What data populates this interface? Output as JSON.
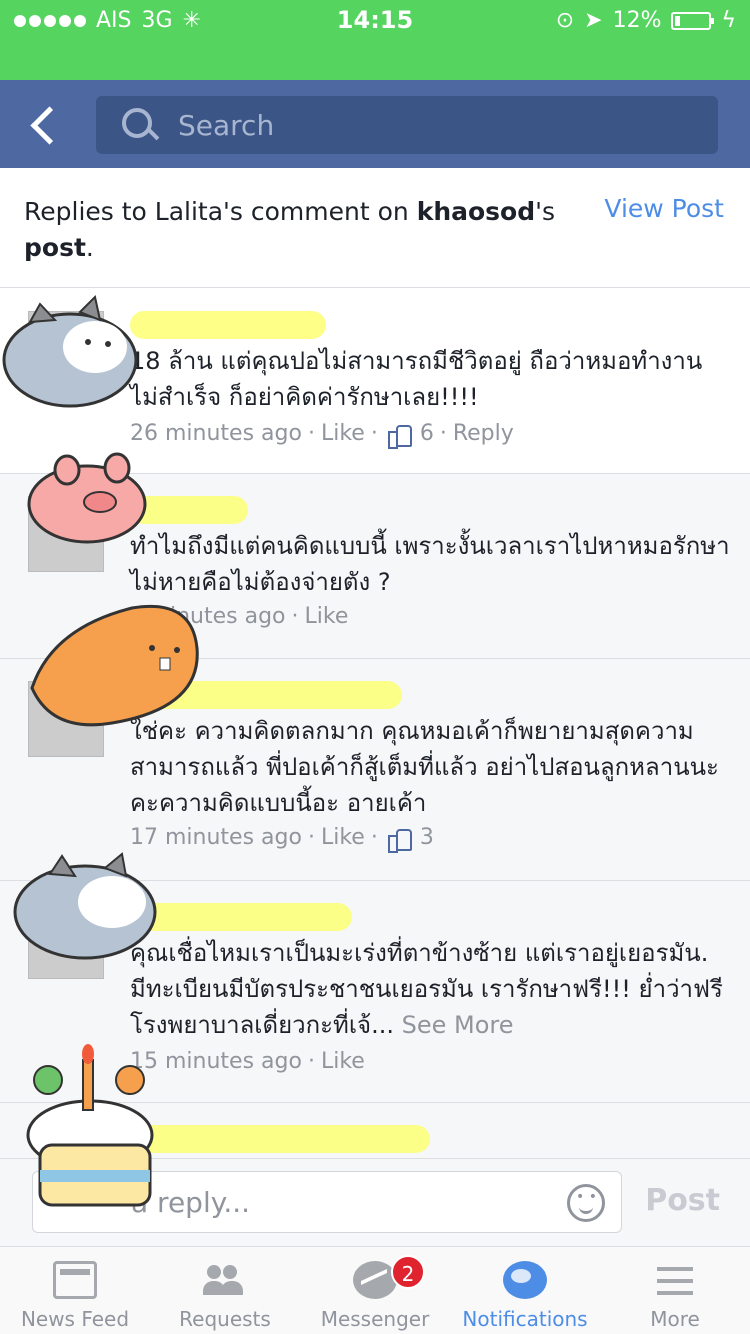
{
  "status": {
    "carrier": "AIS",
    "network": "3G",
    "time": "14:15",
    "battery": "12%"
  },
  "header": {
    "search_placeholder": "Search"
  },
  "replies": {
    "prefix": "Replies to Lalita's comment on ",
    "page": "khaosod",
    "suffix": "'s ",
    "post_word": "post",
    "period": ".",
    "view_post": "View Post"
  },
  "comments": [
    {
      "text": "18 ล้าน แต่คุณปอไม่สามารถมีชีวิตอยู่ ถือว่าหมอทำงานไม่สำเร็จ ก็อย่าคิดค่ารักษาเลย!!!!",
      "time": "26 minutes ago",
      "like": "Like",
      "likes": "6",
      "reply": "Reply"
    },
    {
      "text": "ทำไมถึงมีแต่คนคิดแบบนี้ เพราะงั้นเวลาเราไปหาหมอรักษาไม่หายคือไม่ต้องจ่ายตัง ?",
      "time": "inutes ago",
      "like": "Like"
    },
    {
      "text": "ใช่คะ ความคิดตลกมาก คุณหมอเค้าก็พยายามสุดความสามารถแล้ว พี่ปอเค้าก็สู้เต็มที่แล้ว อย่าไปสอนลูกหลานนะคะความคิดแบบนี้อะ อายเค้า",
      "time": "17 minutes ago",
      "like": "Like",
      "likes": "3"
    },
    {
      "text": "คุณเชื่อไหมเราเป็นมะเร่งที่ตาข้างซ้าย แต่เราอยู่เยอรมัน. มีทะเบียนมีบัตรประชาชนเยอรมัน เรารักษาฟรี!!!  ย่ำว่าฟรี โรงพยาบาลเดี่ยวกะที่เจ้...",
      "see_more": "See More",
      "time": "15 minutes ago",
      "like": "Like"
    }
  ],
  "composer": {
    "placeholder": "a reply...",
    "post": "Post"
  },
  "tabs": [
    {
      "label": "News Feed",
      "icon": "news-feed-icon"
    },
    {
      "label": "Requests",
      "icon": "requests-icon"
    },
    {
      "label": "Messenger",
      "icon": "messenger-icon",
      "badge": "2"
    },
    {
      "label": "Notifications",
      "icon": "notifications-icon",
      "active": true
    },
    {
      "label": "More",
      "icon": "more-icon"
    }
  ],
  "colors": {
    "status_bar": "#55d45f",
    "fb_blue": "#4e69a2",
    "link_blue": "#4e8de6",
    "badge_red": "#e0242f"
  }
}
